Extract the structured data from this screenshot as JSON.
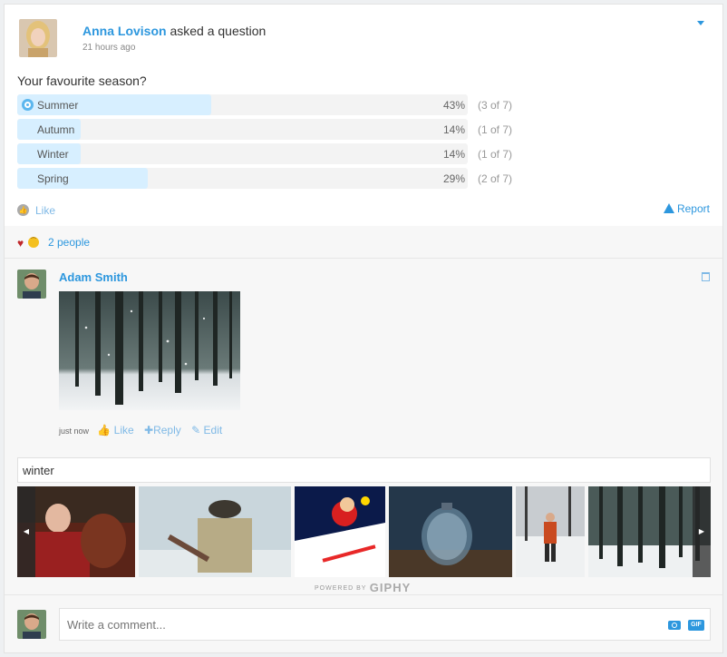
{
  "post": {
    "author": "Anna Lovison",
    "action": "asked a question",
    "time": "21 hours ago",
    "question": "Your favourite season?"
  },
  "poll": {
    "options": [
      {
        "label": "Summer",
        "percent": "43%",
        "count": "(3 of 7)",
        "fraction": 0.43,
        "selected": true
      },
      {
        "label": "Autumn",
        "percent": "14%",
        "count": "(1 of 7)",
        "fraction": 0.14,
        "selected": false
      },
      {
        "label": "Winter",
        "percent": "14%",
        "count": "(1 of 7)",
        "fraction": 0.14,
        "selected": false
      },
      {
        "label": "Spring",
        "percent": "29%",
        "count": "(2 of 7)",
        "fraction": 0.29,
        "selected": false
      }
    ]
  },
  "actions": {
    "like": "Like",
    "report": "Report"
  },
  "reactions": {
    "people": "2 people"
  },
  "comment": {
    "author": "Adam Smith",
    "time": "just now",
    "like": "Like",
    "reply": "Reply",
    "edit": "Edit"
  },
  "gif_search": {
    "value": "winter",
    "powered_by": "POWERED BY",
    "brand": "GIPHY"
  },
  "composer": {
    "placeholder": "Write a comment..."
  },
  "colors": {
    "accent": "#2d97de",
    "poll_fill": "#d7efff",
    "poll_track": "#f3f3f3"
  }
}
